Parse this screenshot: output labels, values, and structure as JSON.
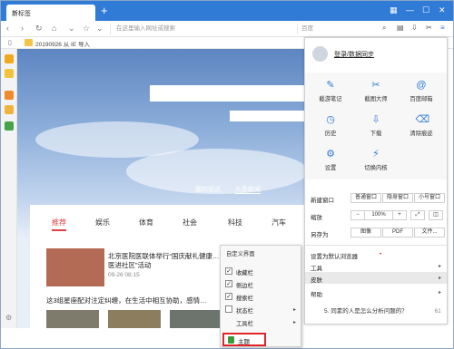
{
  "browser": {
    "tab_title": "新标签",
    "new_tab": "+",
    "address_placeholder": "在这里输入网址或搜索",
    "search_placeholder": "百度",
    "bookmark_folder": "20190926 从 IE 导入"
  },
  "page": {
    "link_my_sites": "我的站点",
    "link_headlines": "头条新闻",
    "categories": [
      "推荐",
      "娱乐",
      "体育",
      "社会",
      "科技",
      "汽车"
    ],
    "news1": "北京医院医联体举行“国庆献礼健康…健康名医进社区”活动",
    "news1_date": "09-26 08:15",
    "news2": "这3组星座配对注定纠缠，在生活中相互协助，感情…",
    "bottom_text": "5. 同素的人是怎么分析问题的？",
    "bottom_num": "61"
  },
  "menu": {
    "login": "登录/数据同步",
    "grid": [
      {
        "label": "截游笔记",
        "icon": "note-icon"
      },
      {
        "label": "截图大师",
        "icon": "screenshot-icon"
      },
      {
        "label": "百度邮箱",
        "icon": "mail-icon"
      },
      {
        "label": "历史",
        "icon": "history-icon"
      },
      {
        "label": "下载",
        "icon": "download-icon"
      },
      {
        "label": "清除痕迹",
        "icon": "clear-icon"
      },
      {
        "label": "设置",
        "icon": "settings-icon"
      },
      {
        "label": "切换内核",
        "icon": "switch-kernel-icon"
      }
    ],
    "new_window": "新建窗口",
    "normal_window": "普通窗口",
    "private_window": "隐身窗口",
    "small_window": "小号窗口",
    "zoom": "缩放",
    "zoom_minus": "−",
    "zoom_value": "100%",
    "zoom_plus": "+",
    "save_as": "另存为",
    "save_image": "图像",
    "save_pdf": "PDF",
    "save_file": "文件...",
    "set_default": "设置为默认浏览器",
    "tools": "工具",
    "skin": "皮肤",
    "help": "帮助"
  },
  "context_menu": {
    "header": "自定义界面",
    "items": [
      {
        "label": "收藏栏",
        "checked": true
      },
      {
        "label": "侧边栏",
        "checked": true
      },
      {
        "label": "搜索栏",
        "checked": true
      },
      {
        "label": "状态栏",
        "checked": false
      },
      {
        "label": "工具栏",
        "checked": false
      }
    ],
    "theme": "主题"
  },
  "colors": {
    "accent": "#2f7bd6",
    "highlight_border": "#e0262a"
  }
}
